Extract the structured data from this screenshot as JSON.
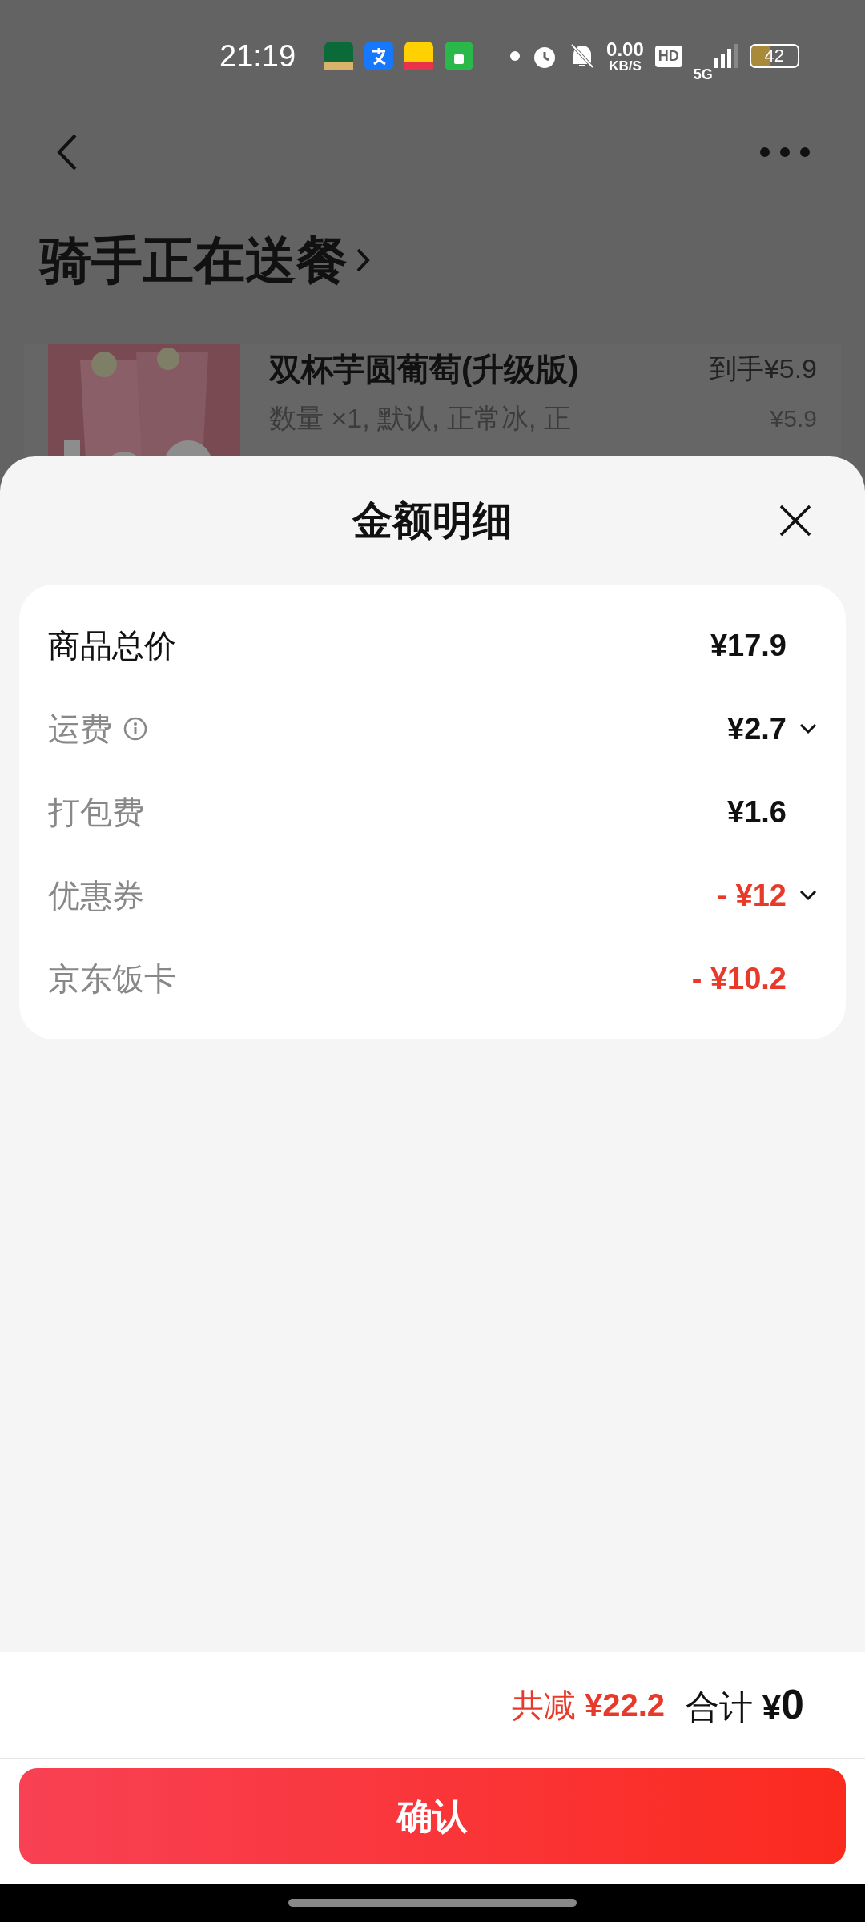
{
  "status_bar": {
    "time": "21:19",
    "net_speed": "0.00",
    "net_unit": "KB/S",
    "hd": "HD",
    "network": "5G",
    "battery": "42"
  },
  "nav": {
    "title": "骑手正在送餐"
  },
  "order_item": {
    "name": "双杯芋圆葡萄(升级版)",
    "final_price": "到手¥5.9",
    "specs": "数量 ×1, 默认, 正常冰, 正",
    "price": "¥5.9"
  },
  "sheet": {
    "title": "金额明细",
    "rows": [
      {
        "label": "商品总价",
        "value": "¥17.9",
        "discount": false,
        "info": false,
        "expandable": false
      },
      {
        "label": "运费",
        "value": "¥2.7",
        "discount": false,
        "info": true,
        "expandable": true
      },
      {
        "label": "打包费",
        "value": "¥1.6",
        "discount": false,
        "info": false,
        "expandable": false
      },
      {
        "label": "优惠券",
        "value": "- ¥12",
        "discount": true,
        "info": false,
        "expandable": true
      },
      {
        "label": "京东饭卡",
        "value": "- ¥10.2",
        "discount": true,
        "info": false,
        "expandable": false
      }
    ],
    "saving_label": "共减",
    "saving_value": "¥22.2",
    "total_label": "合计",
    "total_currency": "¥",
    "total_value": "0",
    "confirm": "确认"
  }
}
